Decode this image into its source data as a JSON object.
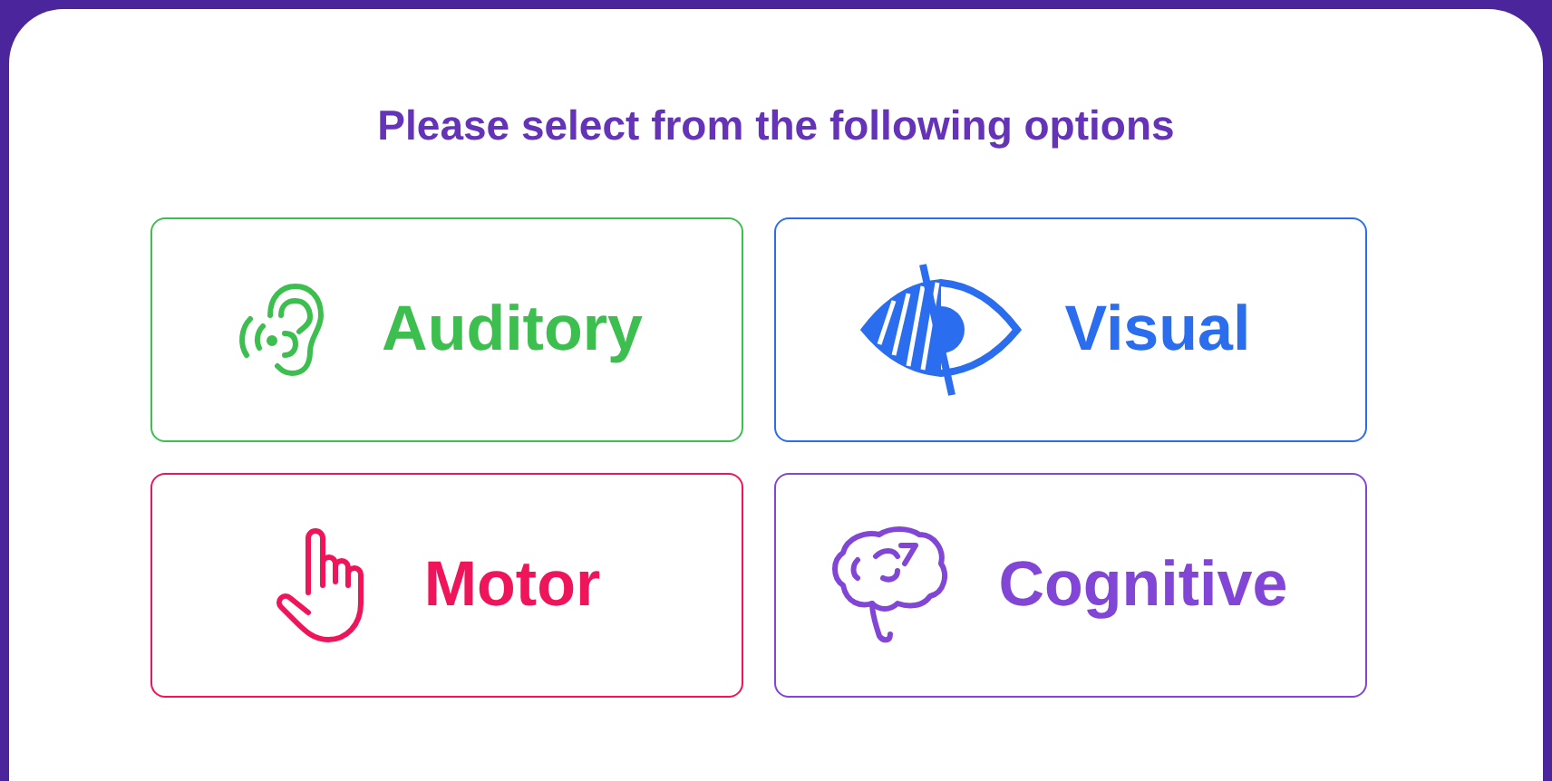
{
  "heading": "Please select from the following options",
  "options": [
    {
      "label": "Auditory",
      "kind": "ear",
      "color": "#3dbf4f"
    },
    {
      "label": "Visual",
      "kind": "eye",
      "color": "#2b6def"
    },
    {
      "label": "Motor",
      "kind": "hand",
      "color": "#f0145a"
    },
    {
      "label": "Cognitive",
      "kind": "brain",
      "color": "#8146d6"
    }
  ]
}
